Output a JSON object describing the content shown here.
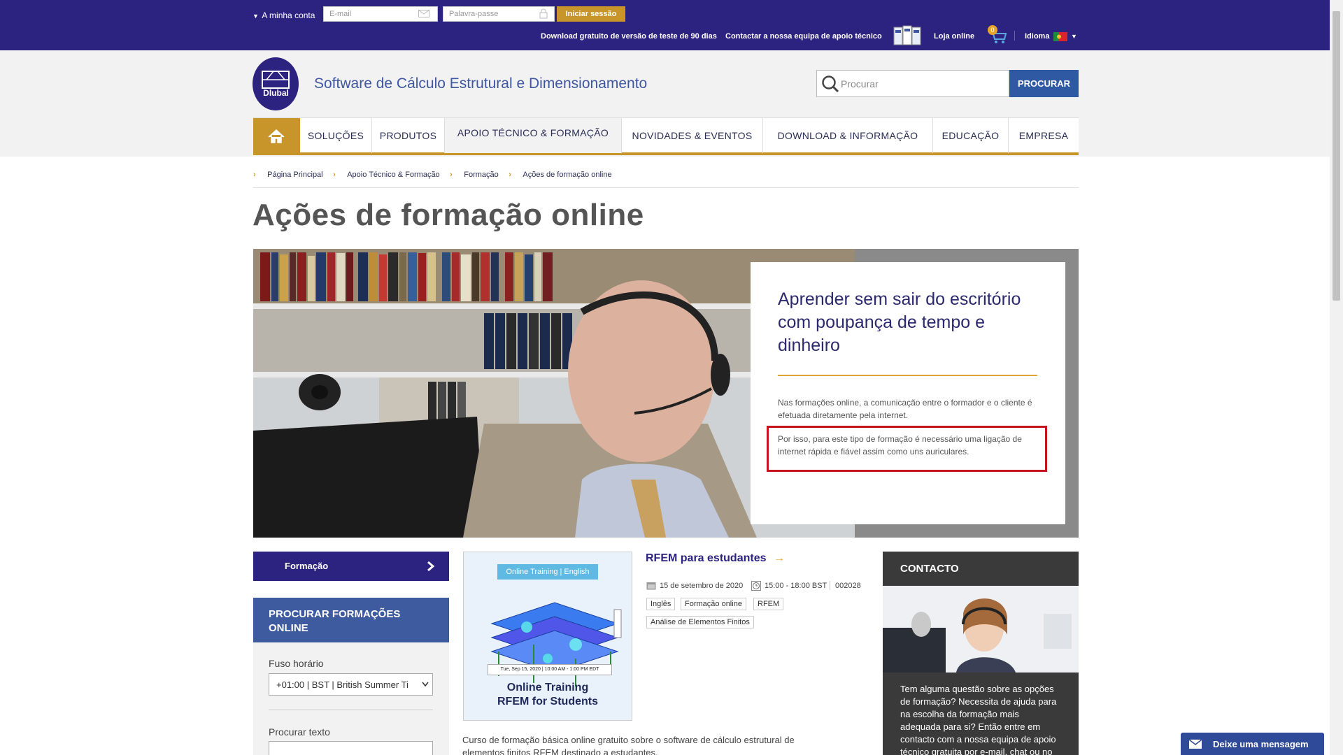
{
  "topbar": {
    "account_label": "A minha conta",
    "email_placeholder": "E-mail",
    "password_placeholder": "Palavra-passe",
    "login_button": "Iniciar sessão",
    "trial_link": "Download gratuito de versão de teste de 90 dias",
    "contact_link": "Contactar a nossa equipa de apoio técnico",
    "shop_link": "Loja online",
    "cart_count": "0",
    "language_label": "Idioma"
  },
  "header": {
    "logo_text": "Dlubal",
    "site_title": "Software de Cálculo Estrutural e Dimensionamento",
    "search_placeholder": "Procurar",
    "search_button": "PROCURAR"
  },
  "nav": {
    "items": [
      {
        "label": "SOLUÇÕES"
      },
      {
        "label": "PRODUTOS"
      },
      {
        "label": "APOIO TÉCNICO & FORMAÇÃO"
      },
      {
        "label": "NOVIDADES & EVENTOS"
      },
      {
        "label": "DOWNLOAD & INFORMAÇÃO"
      },
      {
        "label": "EDUCAÇÃO"
      },
      {
        "label": "EMPRESA"
      }
    ]
  },
  "breadcrumb": [
    {
      "label": "Página Principal"
    },
    {
      "label": "Apoio Técnico & Formação"
    },
    {
      "label": "Formação"
    },
    {
      "label": "Ações de formação online"
    }
  ],
  "page_title": "Ações de formação online",
  "hero": {
    "heading": "Aprender sem sair do escritório com poupança de tempo e dinheiro",
    "paragraph1": "Nas formações online, a comunicação entre o formador e o cliente é efetuada diretamente pela internet.",
    "paragraph2": "Por isso, para este tipo de formação é necessário uma ligação de internet rápida e fiável assim como uns auriculares."
  },
  "sidebar": {
    "section_button": "Formação",
    "panel_title": "PROCURAR FORMAÇÕES ONLINE",
    "timezone_label": "Fuso horário",
    "timezone_value": "+01:00 | BST | British Summer Ti",
    "text_label": "Procurar texto"
  },
  "event": {
    "thumb_badge": "Online Training | English",
    "thumb_date": "Tue, Sep 15, 2020 | 10:00 AM - 1:00 PM EDT",
    "thumb_title_line1": "Online Training",
    "thumb_title_line2": "RFEM for Students",
    "title": "RFEM para estudantes",
    "date": "15 de setembro de 2020",
    "time": "15:00 - 18:00 BST",
    "code": "002028",
    "tags": [
      "Inglês",
      "Formação online",
      "RFEM",
      "Análise de Elementos Finitos"
    ],
    "description": "Curso de formação básica online gratuito sobre o software de cálculo estrutural de elementos finitos RFEM destinado a estudantes."
  },
  "contact": {
    "heading": "CONTACTO",
    "text": "Tem alguma questão sobre as opções de formação? Necessita de ajuda para na escolha da formação mais adequada para si? Então entre em contacto com a nossa equipa de apoio técnico gratuita por e-mail, chat ou no"
  },
  "message_button": "Deixe uma mensagem",
  "colors": {
    "primary_dark_blue": "#2c2280",
    "accent_gold": "#c8952b",
    "link_blue": "#3f57a0",
    "highlight_red": "#c4141c"
  }
}
